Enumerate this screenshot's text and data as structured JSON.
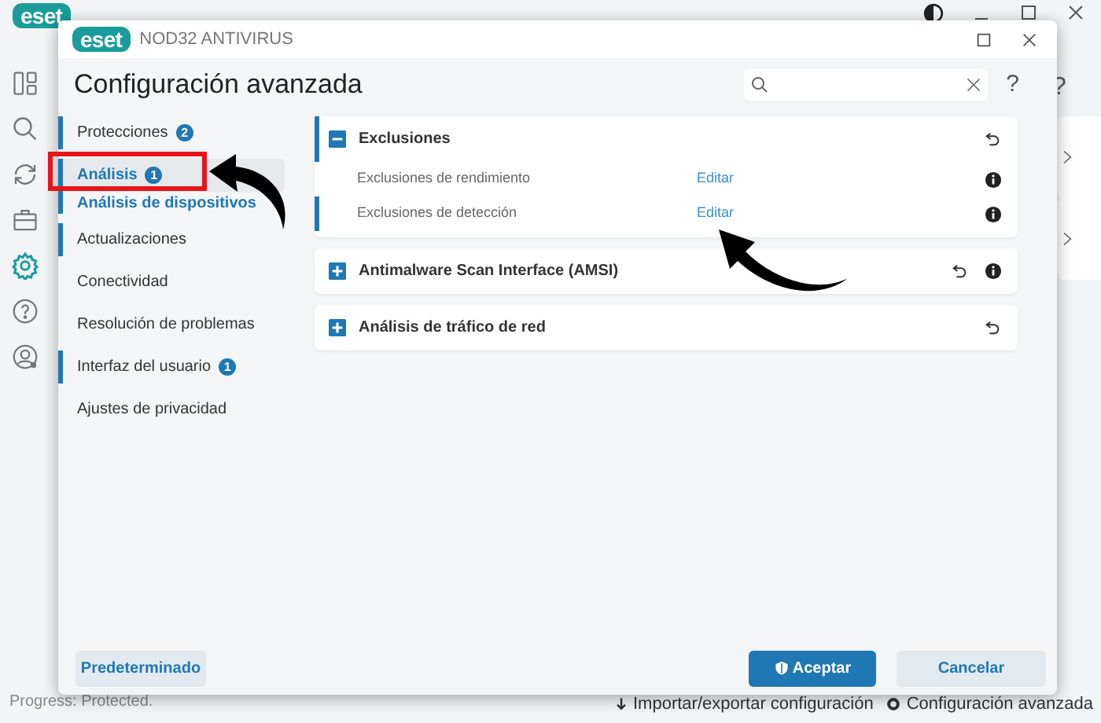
{
  "background_window": {
    "logo": "eset",
    "nav": [
      {
        "kind": "dashboard"
      },
      {
        "kind": "search"
      },
      {
        "kind": "refresh"
      },
      {
        "kind": "briefcase"
      },
      {
        "kind": "gear",
        "selected": true
      },
      {
        "kind": "help"
      },
      {
        "kind": "account"
      }
    ],
    "help": "?",
    "status": "Progress: Protected.",
    "footer_links": [
      {
        "kind": "import",
        "label": "Importar/exportar configuración"
      },
      {
        "kind": "settings",
        "label": "Configuración avanzada"
      }
    ]
  },
  "dialog": {
    "logo": "eset",
    "product": "NOD32 ANTIVIRUS",
    "title": "Configuración avanzada",
    "help": "?",
    "nav": [
      {
        "label": "Protecciones",
        "badge": "2",
        "selected": false,
        "modified": true
      },
      {
        "label": "Análisis",
        "badge": "1",
        "selected": true,
        "modified": true,
        "children": [
          {
            "label": "Análisis de dispositivos"
          }
        ]
      },
      {
        "label": "Actualizaciones",
        "selected": false,
        "modified": true
      },
      {
        "label": "Conectividad",
        "selected": false,
        "modified": false
      },
      {
        "label": "Resolución de problemas",
        "selected": false,
        "modified": false
      },
      {
        "label": "Interfaz del usuario",
        "badge": "1",
        "selected": false,
        "modified": true
      },
      {
        "label": "Ajustes de privacidad",
        "selected": false,
        "modified": false
      }
    ],
    "sections": [
      {
        "title": "Exclusiones",
        "expanded": true,
        "modified": true,
        "info": false,
        "rows": [
          {
            "label": "Exclusiones de rendimiento",
            "link": "Editar",
            "modified": false
          },
          {
            "label": "Exclusiones de detección",
            "link": "Editar",
            "modified": true
          }
        ]
      },
      {
        "title": "Antimalware Scan Interface (AMSI)",
        "expanded": false,
        "modified": false,
        "info": true
      },
      {
        "title": "Análisis de tráfico de red",
        "expanded": false,
        "modified": false,
        "info": false
      }
    ],
    "buttons": [
      {
        "kind": "secondary",
        "label": "Predeterminado"
      },
      {
        "kind": "primary",
        "label": "Aceptar"
      },
      {
        "kind": "cancel",
        "label": "Cancelar"
      }
    ]
  }
}
